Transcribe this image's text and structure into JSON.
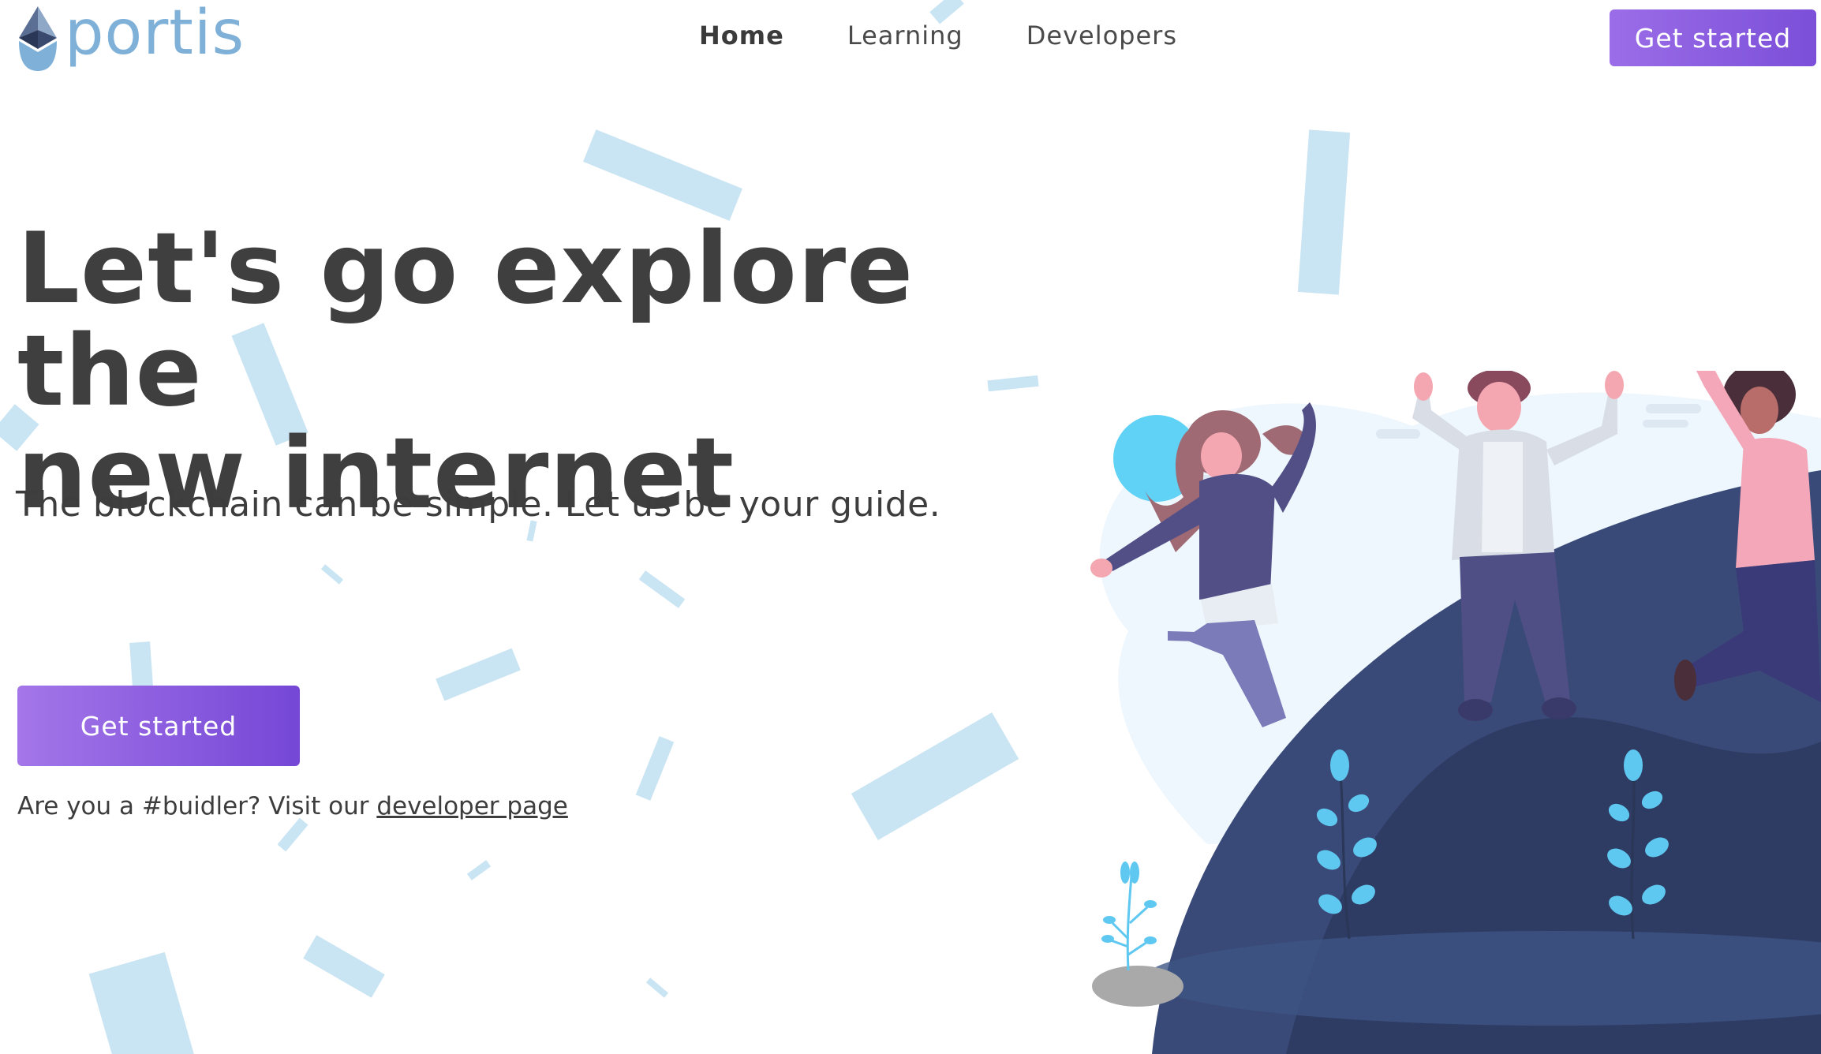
{
  "brand": {
    "name": "portis",
    "logo_icon": "ethereum-diamond-icon",
    "accent_color": "#8a5ee0",
    "logo_color": "#7fb0d8"
  },
  "nav": {
    "items": [
      {
        "label": "Home",
        "active": true
      },
      {
        "label": "Learning",
        "active": false
      },
      {
        "label": "Developers",
        "active": false
      }
    ],
    "cta_label": "Get started"
  },
  "hero": {
    "title_line1": "Let's go explore the",
    "title_line2": "new internet",
    "subtitle": "The blockchain can be simple. Let us be your guide.",
    "cta_label": "Get started",
    "dev_note_prefix": "Are you a #buidler? Visit our ",
    "dev_link_label": "developer page"
  },
  "illustration": {
    "subject": "three people jumping on a hill",
    "colors": {
      "hill_dark": "#2e3b63",
      "hill_mid": "#3a4a78",
      "sun": "#5fd2f5",
      "cloud": "#eaf5fc",
      "leaves": "#5fc8f1",
      "confetti": "#c9e4f3"
    }
  }
}
